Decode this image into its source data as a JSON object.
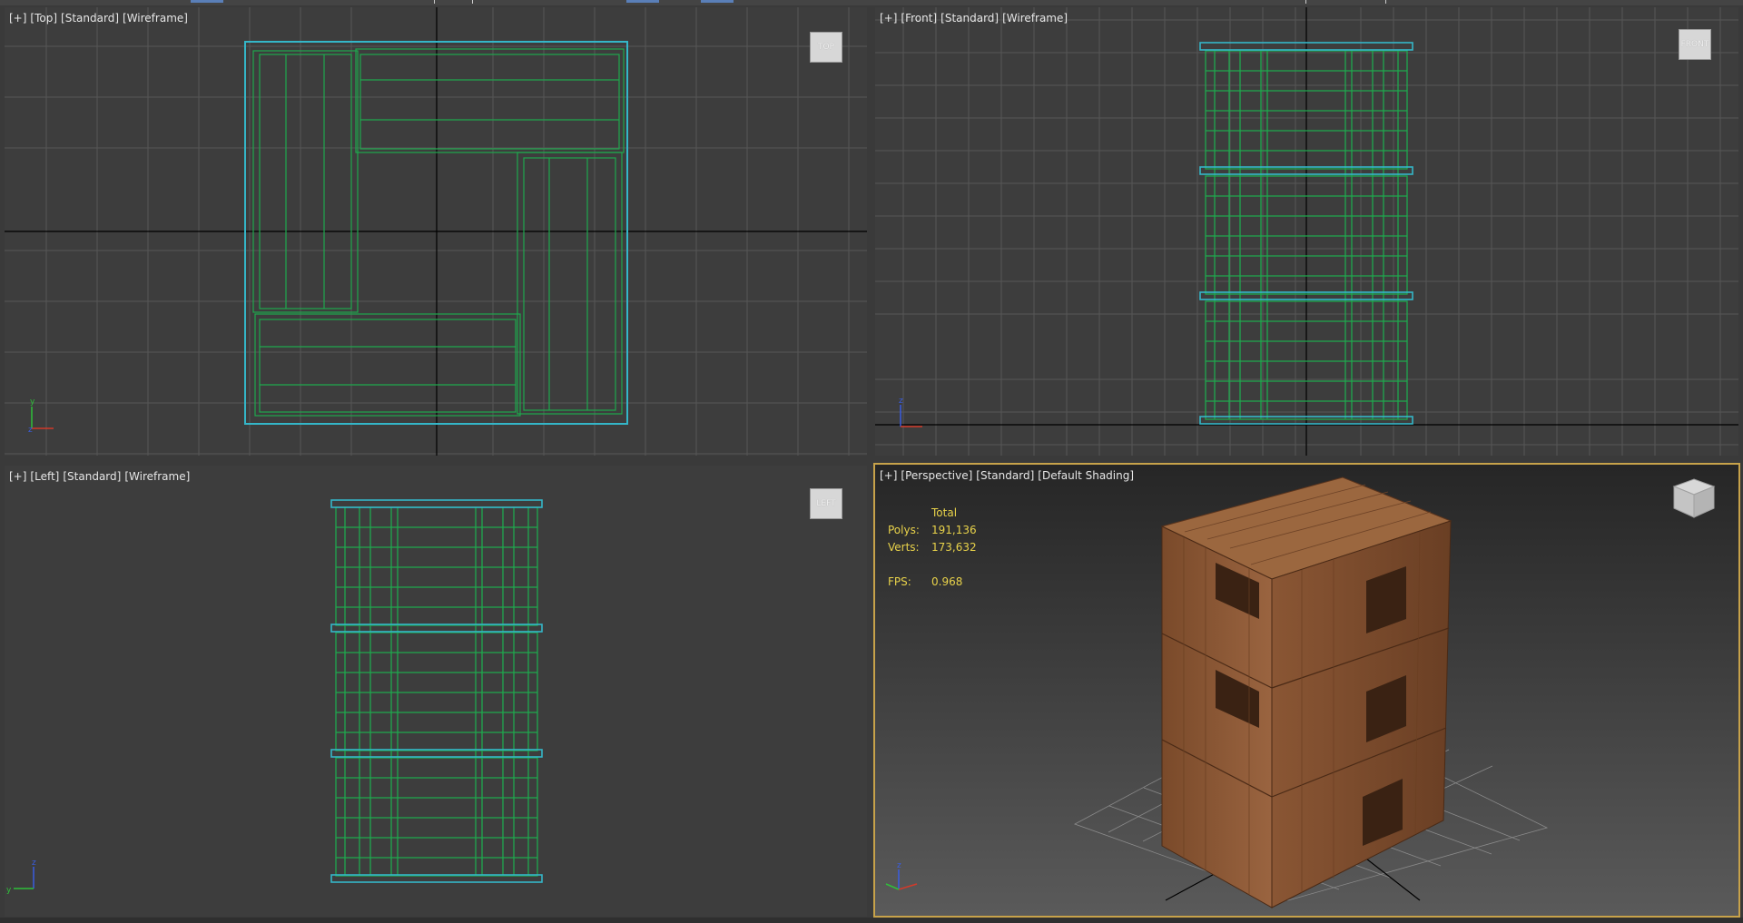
{
  "viewports": {
    "top": {
      "labels": [
        "[+]",
        "[Top]",
        "[Standard]",
        "[Wireframe]"
      ],
      "cube": "TOP"
    },
    "front": {
      "labels": [
        "[+]",
        "[Front]",
        "[Standard]",
        "[Wireframe]"
      ],
      "cube": "FRONT"
    },
    "left": {
      "labels": [
        "[+]",
        "[Left]",
        "[Standard]",
        "[Wireframe]"
      ],
      "cube": "LEFT"
    },
    "perspective": {
      "labels": [
        "[+]",
        "[Perspective]",
        "[Standard]",
        "[Default Shading]"
      ],
      "stats": {
        "header": "Total",
        "polys_label": "Polys:",
        "polys_value": "191,136",
        "verts_label": "Verts:",
        "verts_value": "173,632",
        "fps_label": "FPS:",
        "fps_value": "0.968"
      }
    }
  },
  "colors": {
    "viewport_bg": "#3d3d3d",
    "grid": "#555555",
    "wire": "#1fa84e",
    "selection": "#34b6c8",
    "active_border": "#c7a24a",
    "stats_text": "#e8d24a",
    "wood": "#8a5a35"
  },
  "axis_icons": [
    "axis-tripod-icon"
  ]
}
